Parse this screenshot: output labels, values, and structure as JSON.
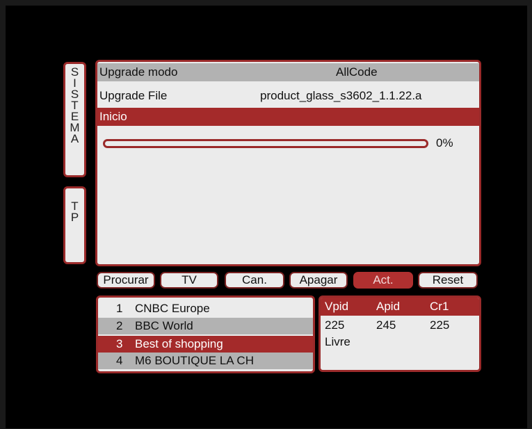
{
  "sidebar": {
    "tab_sistema": [
      "S",
      "I",
      "S",
      "T",
      "E",
      "M",
      "A"
    ],
    "tab_tp": [
      "T",
      "P"
    ]
  },
  "upgrade": {
    "mode_label": "Upgrade modo",
    "mode_value": "AllCode",
    "file_label": "Upgrade File",
    "file_value": "product_glass_s3602_1.1.22.a",
    "start_label": "Inicio",
    "progress_text": "0%",
    "progress_percent": 0
  },
  "buttons": [
    {
      "label": "Procurar",
      "active": false
    },
    {
      "label": "TV",
      "active": false
    },
    {
      "label": "Can.",
      "active": false
    },
    {
      "label": "Apagar",
      "active": false
    },
    {
      "label": "Act.",
      "active": true
    },
    {
      "label": "Reset",
      "active": false
    }
  ],
  "channels": [
    {
      "num": "1",
      "name": "CNBC Europe",
      "style": "white"
    },
    {
      "num": "2",
      "name": "BBC World",
      "style": "grey"
    },
    {
      "num": "3",
      "name": "Best of shopping",
      "style": "red"
    },
    {
      "num": "4",
      "name": "M6 BOUTIQUE LA CH",
      "style": "grey"
    }
  ],
  "info": {
    "headers": [
      "Vpid",
      "Apid",
      "Cr1"
    ],
    "values": [
      "225",
      "245",
      "225"
    ],
    "status": "Livre"
  },
  "colors": {
    "accent": "#a42a2a",
    "panel": "#ebebeb",
    "row_grey": "#b2b2b2"
  }
}
